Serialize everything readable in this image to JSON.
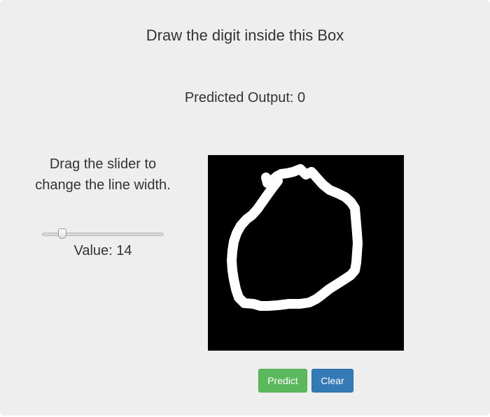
{
  "title": "Draw the digit inside this Box",
  "prediction": {
    "label": "Predicted Output:",
    "value": "0"
  },
  "slider": {
    "instructions": "Drag the slider to change the line width.",
    "value_label": "Value:",
    "value": 14,
    "min": 1,
    "max": 100
  },
  "canvas": {
    "background": "#000000",
    "stroke_color": "#ffffff"
  },
  "buttons": {
    "predict_label": "Predict",
    "clear_label": "Clear",
    "predict_color": "#5cb85c",
    "clear_color": "#337ab7"
  }
}
